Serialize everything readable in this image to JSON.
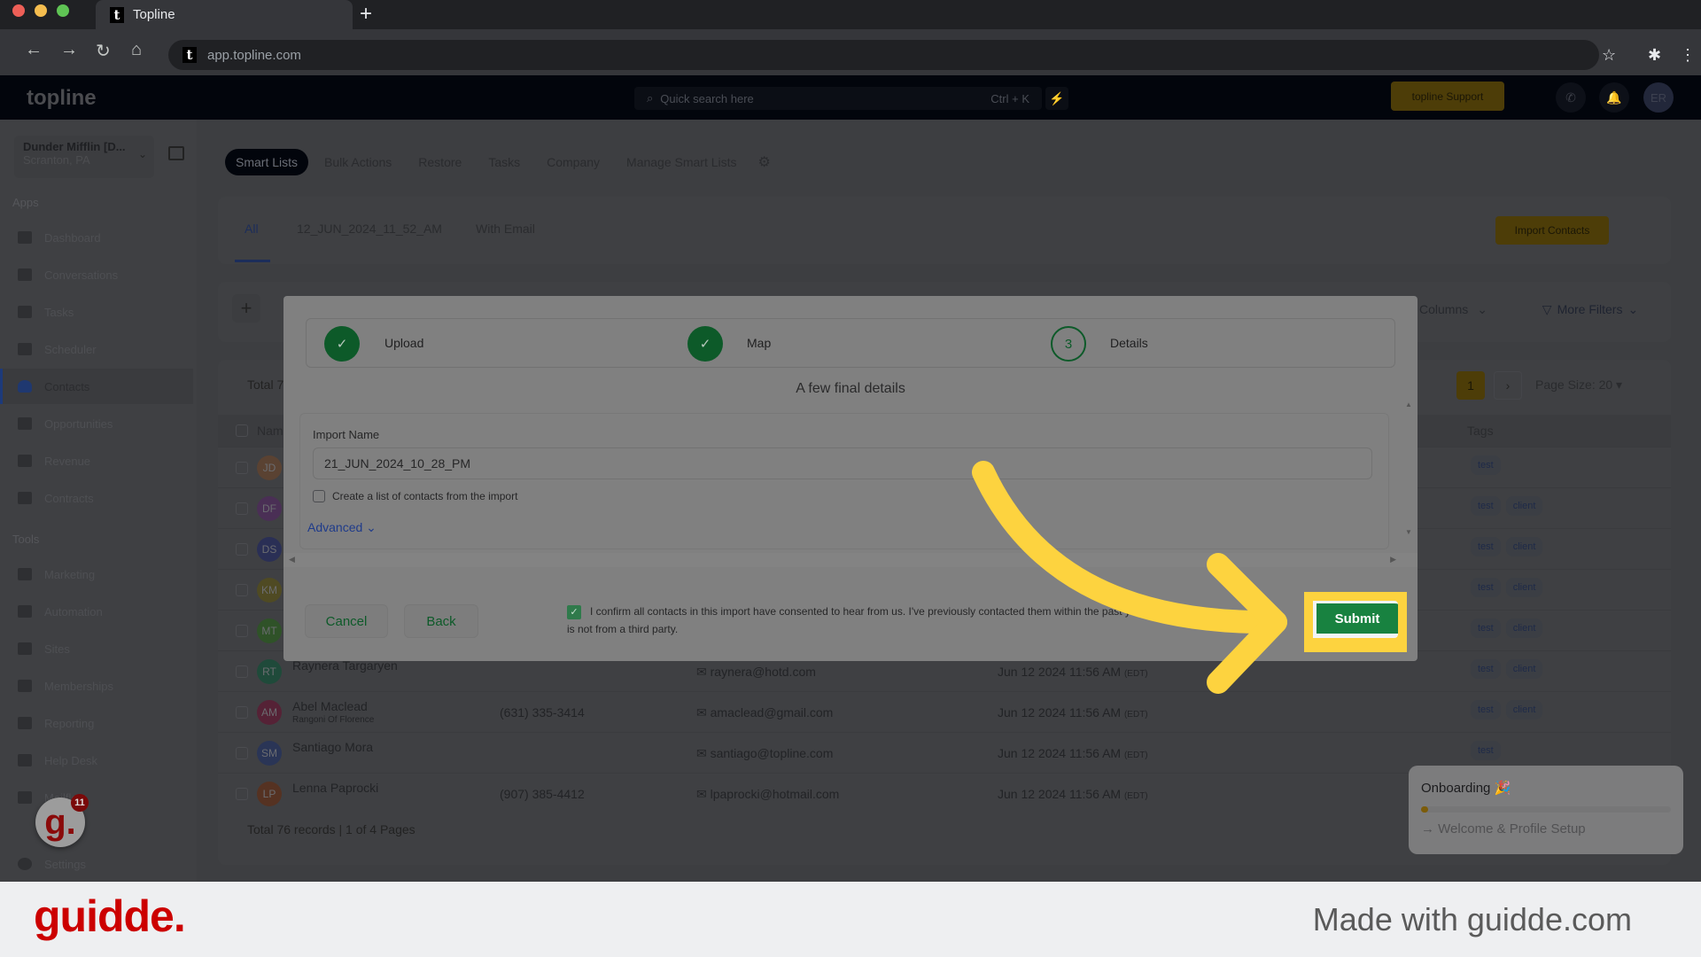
{
  "browser": {
    "tab_title": "Topline",
    "new_tab": "+",
    "url": "app.topline.com"
  },
  "header": {
    "logo": "topline",
    "search_placeholder": "Quick search here",
    "search_shortcut": "Ctrl + K",
    "support_label": "topline Support",
    "avatar_initials": "ER"
  },
  "sidebar": {
    "location_name": "Dunder Mifflin [D...",
    "location_city": "Scranton, PA",
    "apps_label": "Apps",
    "tools_label": "Tools",
    "apps": [
      {
        "label": "Dashboard"
      },
      {
        "label": "Conversations"
      },
      {
        "label": "Tasks"
      },
      {
        "label": "Scheduler"
      },
      {
        "label": "Contacts",
        "active": true
      },
      {
        "label": "Opportunities"
      },
      {
        "label": "Revenue"
      },
      {
        "label": "Contracts"
      }
    ],
    "tools": [
      {
        "label": "Marketing"
      },
      {
        "label": "Automation"
      },
      {
        "label": "Sites"
      },
      {
        "label": "Memberships"
      },
      {
        "label": "Reporting"
      },
      {
        "label": "Help Desk"
      },
      {
        "label": "Mailflow"
      }
    ],
    "settings_label": "Settings",
    "guidde_badge_count": "11"
  },
  "topnav": {
    "items": [
      "Smart Lists",
      "Bulk Actions",
      "Restore",
      "Tasks",
      "Company",
      "Manage Smart Lists"
    ],
    "active": "Smart Lists"
  },
  "list_tabs": {
    "items": [
      "All",
      "12_JUN_2024_11_52_AM",
      "With Email"
    ],
    "active": "All",
    "import_button": "Import Contacts"
  },
  "toolbar": {
    "columns_label": "Columns",
    "more_filters_label": "More Filters"
  },
  "table": {
    "total_top": "Total 7",
    "current_page": "1",
    "page_size": "Page Size: 20",
    "headers": {
      "name": "Name",
      "tags": "Tags"
    },
    "rows": [
      {
        "initials": "JD",
        "color": "#5a4232",
        "name": "",
        "company": "",
        "phone": "",
        "email": "",
        "date": "",
        "tz": "",
        "tags": [
          "test"
        ]
      },
      {
        "initials": "DF",
        "color": "#4a2f55",
        "name": "",
        "company": "",
        "phone": "",
        "email": "",
        "date": "",
        "tz": "",
        "tags": [
          "test",
          "client"
        ]
      },
      {
        "initials": "DS",
        "color": "#2a2f55",
        "name": "",
        "company": "",
        "phone": "",
        "email": "",
        "date": "",
        "tz": "",
        "tags": [
          "test",
          "client"
        ]
      },
      {
        "initials": "KM",
        "color": "#4f4a23",
        "name": "",
        "company": "",
        "phone": "",
        "email": "",
        "date": "",
        "tz": "",
        "tags": [
          "test",
          "client"
        ]
      },
      {
        "initials": "MT",
        "color": "#2f5228",
        "name": "",
        "company": "",
        "phone": "",
        "email": "",
        "date": "",
        "tz": "",
        "tags": [
          "test",
          "client"
        ]
      },
      {
        "initials": "RT",
        "color": "#1f4a3a",
        "name": "Raynera Targaryen",
        "company": "",
        "phone": "",
        "email": "raynera@hotd.com",
        "date": "Jun 12 2024 11:56 AM",
        "tz": "(EDT)",
        "tags": [
          "test",
          "client"
        ]
      },
      {
        "initials": "AM",
        "color": "#552236",
        "name": "Abel Maclead",
        "company": "Rangoni Of Florence",
        "phone": "(631) 335-3414",
        "email": "amaclead@gmail.com",
        "date": "Jun 12 2024 11:56 AM",
        "tz": "(EDT)",
        "tags": [
          "test",
          "client"
        ]
      },
      {
        "initials": "SM",
        "color": "#2a3556",
        "name": "Santiago Mora",
        "company": "",
        "phone": "",
        "email": "santiago@topline.com",
        "date": "Jun 12 2024 11:56 AM",
        "tz": "(EDT)",
        "tags": [
          "test"
        ]
      },
      {
        "initials": "LP",
        "color": "#553222",
        "name": "Lenna Paprocki",
        "company": "",
        "phone": "(907) 385-4412",
        "email": "lpaprocki@hotmail.com",
        "date": "Jun 12 2024 11:56 AM",
        "tz": "(EDT)",
        "tags": []
      }
    ],
    "total_bottom": "Total 76 records | 1 of 4 Pages"
  },
  "onboarding": {
    "title": "Onboarding 🎉",
    "progress_percent": 3,
    "next_step": "Welcome & Profile Setup"
  },
  "modal": {
    "steps": [
      {
        "label": "Upload",
        "state": "done"
      },
      {
        "label": "Map",
        "state": "done"
      },
      {
        "label": "Details",
        "state": "current",
        "number": "3"
      }
    ],
    "title": "A few final details",
    "import_name_label": "Import Name",
    "import_name_value": "21_JUN_2024_10_28_PM",
    "create_list_label": "Create a list of contacts from the import",
    "create_list_checked": false,
    "advanced_label": "Advanced",
    "cancel_label": "Cancel",
    "back_label": "Back",
    "consent_text": "I confirm all contacts in this import have consented to hear from us. I've previously contacted them within the past year and this list is not from a third party.",
    "consent_checked": true,
    "submit_label": "Submit"
  },
  "footer": {
    "brand": "guidde.",
    "tagline": "Made with guidde.com"
  },
  "colors": {
    "accent_green": "#188240",
    "highlight_yellow": "#fdd33f",
    "brand_red": "#cc0000"
  }
}
